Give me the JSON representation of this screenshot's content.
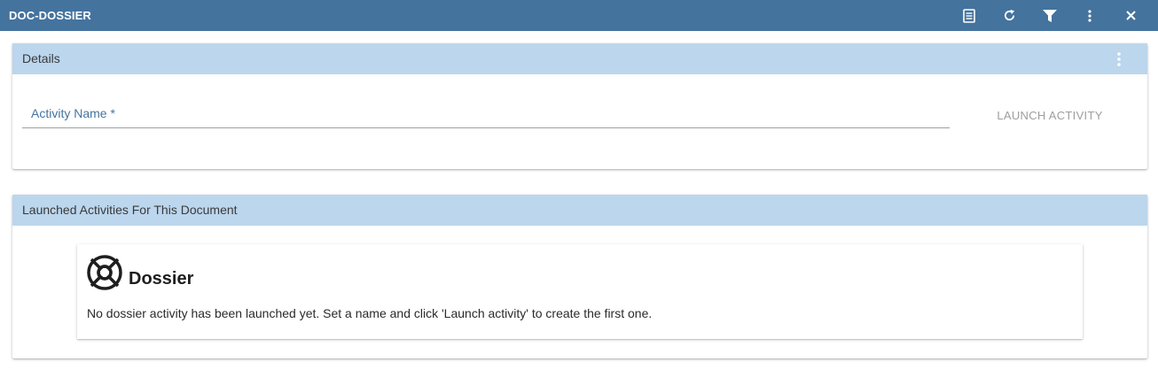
{
  "window": {
    "title": "DOC-DOSSIER",
    "toolbar_icons": [
      "document-icon",
      "refresh-icon",
      "filter-icon",
      "more-vertical-icon",
      "close-icon"
    ]
  },
  "details": {
    "header": "Details",
    "activity_name_label": "Activity Name *",
    "activity_name_value": "",
    "launch_button": "LAUNCH ACTIVITY"
  },
  "launched": {
    "header": "Launched Activities For This Document",
    "card": {
      "icon": "dossier-icon",
      "title": "Dossier",
      "message": "No dossier activity has been launched yet. Set a name and click 'Launch activity' to create the first one."
    }
  },
  "colors": {
    "topbar": "#44739e",
    "panel_header": "#bbd6ed",
    "accent_label": "#44739e",
    "disabled_text": "#9e9e9e"
  }
}
